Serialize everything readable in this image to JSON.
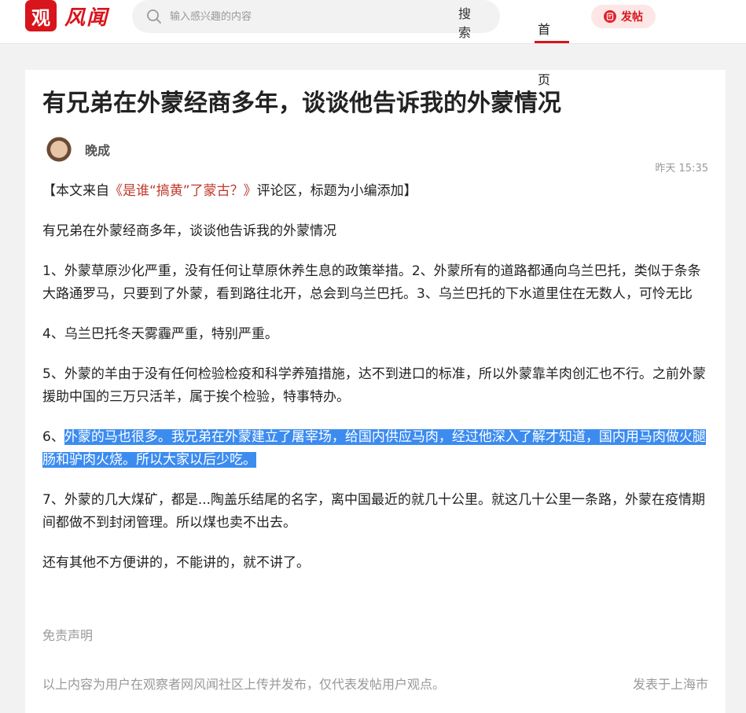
{
  "header": {
    "logo_mark": "观",
    "logo_text": "风闻",
    "search_placeholder": "输入感兴趣的内容",
    "search_button": "搜索",
    "nav_home": "首页",
    "post_button": "发帖"
  },
  "article": {
    "title": "有兄弟在外蒙经商多年，谈谈他告诉我的外蒙情况",
    "author": "晚成",
    "time": "昨天 15:35",
    "source_prefix": "【本文来自",
    "source_link": "《是谁“搞黄”了蒙古？》",
    "source_suffix": "评论区，标题为小编添加】",
    "paragraphs": {
      "p1": "有兄弟在外蒙经商多年，谈谈他告诉我的外蒙情况",
      "p2": "1、外蒙草原沙化严重，没有任何让草原休养生息的政策举措。2、外蒙所有的道路都通向乌兰巴托，类似于条条大路通罗马，只要到了外蒙，看到路往北开，总会到乌兰巴托。3、乌兰巴托的下水道里住在无数人，可怜无比",
      "p3": "4、乌兰巴托冬天雾霾严重，特别严重。",
      "p4": "5、外蒙的羊由于没有任何检验检疫和科学养殖措施，达不到进口的标准，所以外蒙靠羊肉创汇也不行。之前外蒙援助中国的三万只活羊，属于挨个检验，特事特办。",
      "p5_prefix": "6、",
      "p5_highlight": "外蒙的马也很多。我兄弟在外蒙建立了屠宰场，给国内供应马肉，经过他深入了解才知道，国内用马肉做火腿肠和驴肉火烧。所以大家以后少吃。",
      "p6": "7、外蒙的几大煤矿，都是...陶盖乐结尾的名字，离中国最近的就几十公里。就这几十公里一条路，外蒙在疫情期间都做不到封闭管理。所以煤也卖不出去。",
      "p7": "还有其他不方便讲的，不能讲的，就不讲了。"
    },
    "disclaimer_title": "免责声明",
    "footer_note": "以上内容为用户在观察者网风闻社区上传并发布，仅代表发帖用户观点。",
    "footer_location": "发表于上海市"
  },
  "colors": {
    "brand_red": "#d8141c",
    "link_red": "#c0392b",
    "selection_blue": "#3c8cf0"
  },
  "icons": {
    "search": "search-icon",
    "post": "post-icon"
  }
}
